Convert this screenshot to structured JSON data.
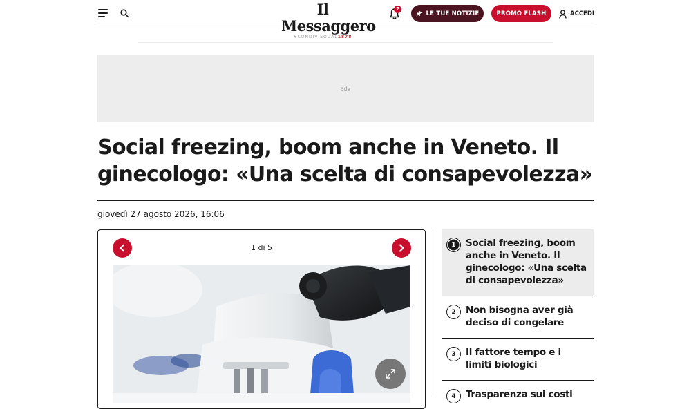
{
  "header": {
    "logo_name": "Il Messaggero",
    "logo_tag_prefix": "#CONDIVISODAL",
    "logo_tag_year": "1878",
    "notification_count": "2",
    "btn_notizie": "LE TUE NOTIZIE",
    "btn_promo": "PROMO FLASH",
    "accedi": "ACCEDI"
  },
  "adv": {
    "label": "adv"
  },
  "article": {
    "headline": "Social freezing, boom anche in Veneto. Il ginecologo: «Una scelta di consapevolezza»",
    "date": "giovedì 27 agosto 2026, 16:06"
  },
  "gallery": {
    "counter": "1 di 5"
  },
  "toc": [
    {
      "num": "1",
      "title": "Social freezing, boom anche in Veneto. Il ginecologo: «Una scelta di consapevolezza»"
    },
    {
      "num": "2",
      "title": "Non bisogna aver già deciso di congelare"
    },
    {
      "num": "3",
      "title": "Il fattore tempo e i limiti biologici"
    },
    {
      "num": "4",
      "title": "Trasparenza sui costi"
    }
  ],
  "icons": {
    "menu": "hamburger-menu-icon",
    "search": "search-icon",
    "bell": "bell-icon",
    "pin": "pin-icon",
    "user": "user-icon",
    "prev": "chevron-left-icon",
    "next": "chevron-right-icon",
    "expand": "expand-icon"
  },
  "colors": {
    "brand_red": "#c8102e",
    "notizie_bg": "#4a1420",
    "text": "#1a1a1a"
  }
}
